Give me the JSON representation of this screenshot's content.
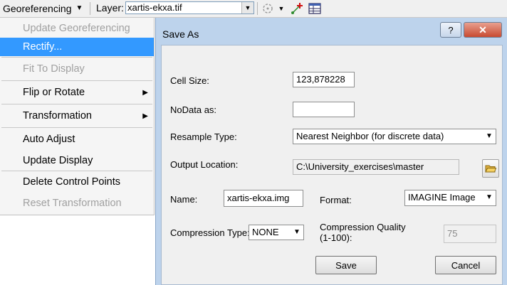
{
  "toolbar": {
    "georef_label": "Georeferencing",
    "layer_label": "Layer:",
    "layer_value": "xartis-ekxa.tif",
    "icons": [
      "rotate-icon",
      "add-control-points-icon",
      "link-table-icon"
    ]
  },
  "menu": {
    "items": [
      {
        "label": "Update Georeferencing",
        "state": "disabled"
      },
      {
        "label": "Rectify...",
        "state": "selected"
      },
      {
        "label": "Fit To Display",
        "state": "disabled"
      },
      {
        "label": "Flip or Rotate",
        "state": "enabled",
        "submenu": true
      },
      {
        "label": "Transformation",
        "state": "enabled",
        "submenu": true
      },
      {
        "label": "Auto Adjust",
        "state": "enabled"
      },
      {
        "label": "Update Display",
        "state": "enabled"
      },
      {
        "label": "Delete Control Points",
        "state": "enabled"
      },
      {
        "label": "Reset Transformation",
        "state": "disabled"
      }
    ]
  },
  "dialog": {
    "title": "Save As",
    "help_label": "?",
    "close_label": "✕",
    "cell_size_label": "Cell Size:",
    "cell_size_value": "123,878228",
    "nodata_label": "NoData as:",
    "nodata_value": "",
    "resample_label": "Resample Type:",
    "resample_value": "Nearest Neighbor (for discrete data)",
    "output_label": "Output Location:",
    "output_value": "C:\\University_exercises\\master",
    "name_label": "Name:",
    "name_value": "xartis-ekxa.img",
    "format_label": "Format:",
    "format_value": "IMAGINE Image",
    "compression_type_label": "Compression Type:",
    "compression_type_value": "NONE",
    "compression_quality_label_1": "Compression Quality",
    "compression_quality_label_2": "(1-100):",
    "compression_quality_value": "75",
    "save_label": "Save",
    "cancel_label": "Cancel"
  },
  "colors": {
    "selected_bg": "#3399ff",
    "dialog_frame": "#bdd3ec",
    "close_red": "#c84a30",
    "disabled_text": "#a0a0a0"
  }
}
